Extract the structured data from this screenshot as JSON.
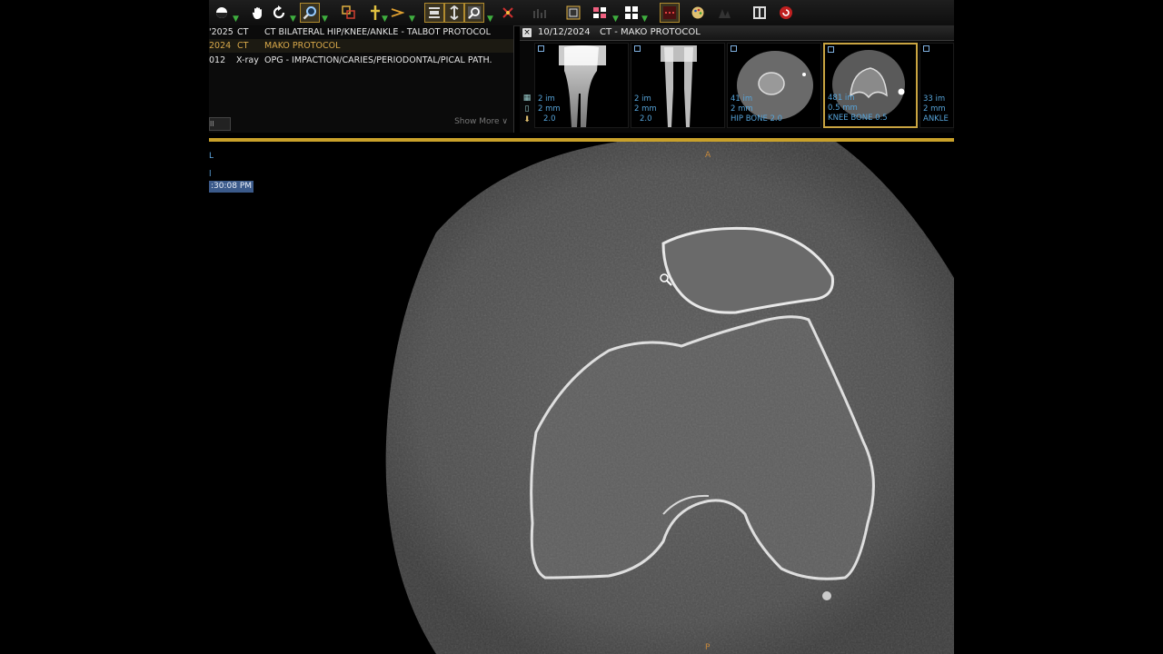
{
  "toolbar": {
    "icons": [
      "contrast-icon",
      "pan-hand-icon",
      "rotate-icon",
      "zoom-icon",
      "roi-icon",
      "crosshair-icon",
      "measure-angle-icon",
      "stack-icon",
      "scroll-icon",
      "magnifier-icon",
      "reference-line-icon",
      "grid-disabled-icon",
      "fit-window-icon",
      "layout-icon",
      "tile-icon",
      "hanging-protocol-icon",
      "palette-icon",
      "shapes-disabled-icon",
      "dicom-info-icon",
      "close-study-icon"
    ]
  },
  "studies": {
    "rows": [
      {
        "date": "'2025",
        "modality": "CT",
        "description": "CT BILATERAL HIP/KNEE/ANKLE - TALBOT PROTOCOL",
        "highlighted": false
      },
      {
        "date": "2024",
        "modality": "CT",
        "description": "MAKO PROTOCOL",
        "highlighted": true
      },
      {
        "date": "012",
        "modality": "X-ray",
        "description": "OPG - IMPACTION/CARIES/PERIODONTAL/PICAL PATH.",
        "highlighted": false
      }
    ],
    "filter_value": "ll",
    "show_more_label": "Show More ∨"
  },
  "series": {
    "header_date": "10/12/2024",
    "header_title": "CT - MAKO PROTOCOL",
    "thumbnails": [
      {
        "line1": "2 im",
        "line2": "2 mm",
        "line3": "2.0",
        "kind": "legs",
        "selected": false
      },
      {
        "line1": "2 im",
        "line2": "2 mm",
        "line3": "2.0",
        "kind": "legs",
        "selected": false
      },
      {
        "line1": "41 im",
        "line2": "2 mm",
        "line3": "HIP BONE 2.0",
        "kind": "hip",
        "selected": false
      },
      {
        "line1": "481 im",
        "line2": "0.5 mm",
        "line3": "KNEE BONE 0.5",
        "kind": "knee",
        "selected": true
      },
      {
        "line1": "33 im",
        "line2": "2 mm",
        "line3": "ANKLE",
        "kind": "ankle",
        "selected": false
      }
    ]
  },
  "viewport": {
    "overlay_line1": "L",
    "overlay_line2": "l",
    "overlay_time": ":30:08 PM",
    "orient_top": "A",
    "orient_bottom": "P"
  },
  "colors": {
    "accent": "#c9a12a",
    "info_text": "#56a3d8",
    "highlight_text": "#d8a84a"
  }
}
